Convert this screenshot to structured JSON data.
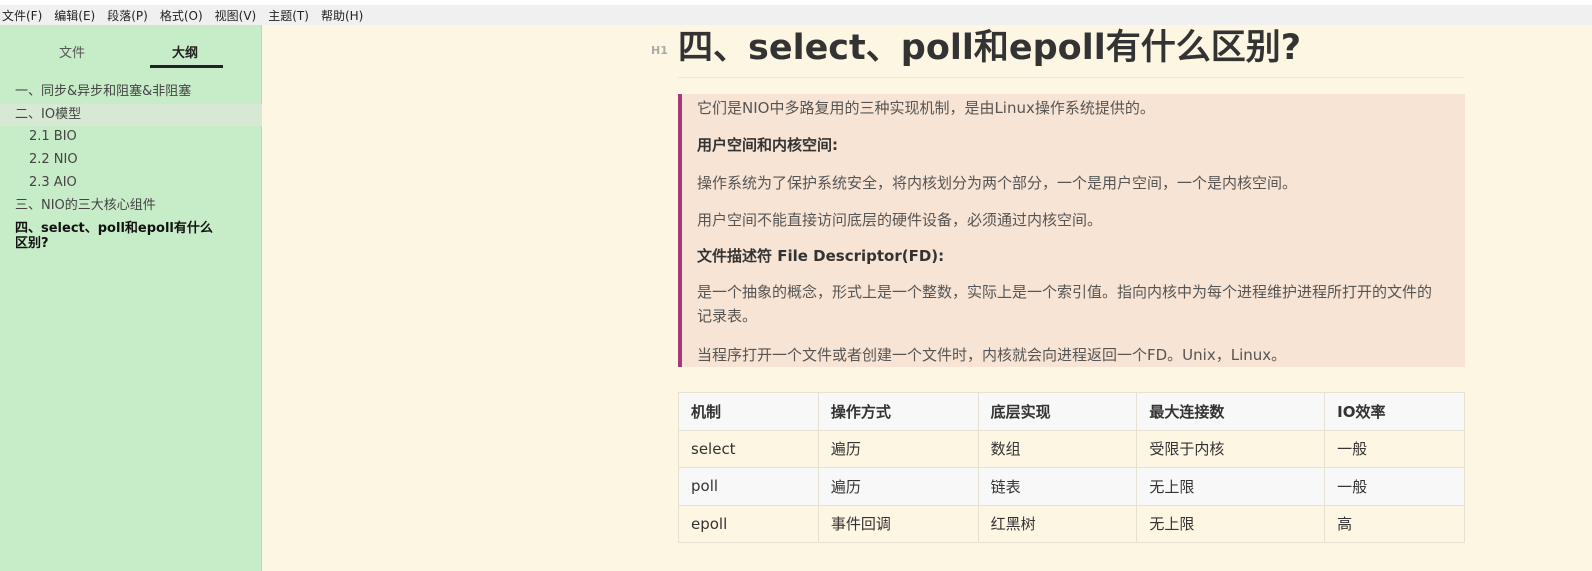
{
  "menu": [
    "文件(F)",
    "编辑(E)",
    "段落(P)",
    "格式(O)",
    "视图(V)",
    "主题(T)",
    "帮助(H)"
  ],
  "sidebar": {
    "tabs": {
      "files": "文件",
      "outline": "大纲"
    },
    "items": [
      "一、同步&异步和阻塞&非阻塞",
      "二、IO模型",
      "2.1 BIO",
      "2.2 NIO",
      "2.3 AIO",
      "三、NIO的三大核心组件",
      "四、select、poll和epoll有什么区别?"
    ]
  },
  "doc": {
    "heading_badge": "H1",
    "title": "四、select、poll和epoll有什么区别?",
    "quote": {
      "p1": "它们是NIO中多路复用的三种实现机制，是由Linux操作系统提供的。",
      "h_space": "用户空间和内核空间:",
      "p2": "操作系统为了保护系统安全，将内核划分为两个部分，一个是用户空间，一个是内核空间。",
      "p3": "用户空间不能直接访问底层的硬件设备，必须通过内核空间。",
      "h_fd": "文件描述符 File Descriptor(FD):",
      "p4": "是一个抽象的概念，形式上是一个整数，实际上是一个索引值。指向内核中为每个进程维护进程所打开的文件的记录表。",
      "p5": "当程序打开一个文件或者创建一个文件时，内核就会向进程返回一个FD。Unix，Linux。"
    },
    "table": {
      "headers": [
        "机制",
        "操作方式",
        "底层实现",
        "最大连接数",
        "IO效率"
      ],
      "rows": [
        [
          "select",
          "遍历",
          "数组",
          "受限于内核",
          "一般"
        ],
        [
          "poll",
          "遍历",
          "链表",
          "无上限",
          "一般"
        ],
        [
          "epoll",
          "事件回调",
          "红黑树",
          "无上限",
          "高"
        ]
      ]
    }
  }
}
